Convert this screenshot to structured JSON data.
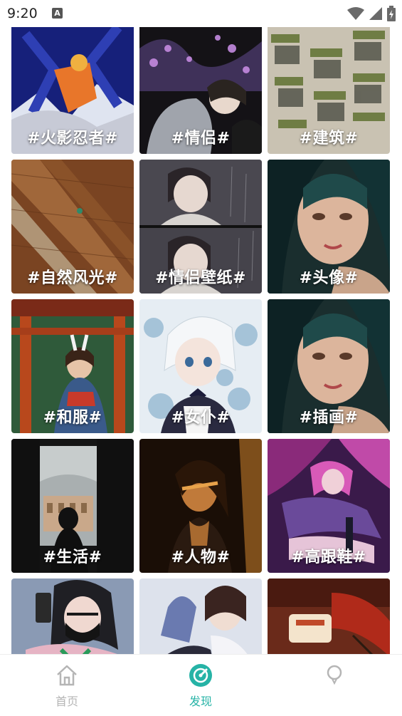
{
  "status_bar": {
    "time": "9:20",
    "notification_glyph": "A"
  },
  "tiles": [
    {
      "label": "#火影忍者#",
      "colors": [
        "#101a6b",
        "#2c3aa8",
        "#e8762a"
      ]
    },
    {
      "label": "#情侣#",
      "colors": [
        "#141216",
        "#3e3550",
        "#b07ad0"
      ]
    },
    {
      "label": "#建筑#",
      "colors": [
        "#b8b2a4",
        "#7d8b55",
        "#dcd6c8"
      ]
    },
    {
      "label": "#自然风光#",
      "colors": [
        "#6b3a1c",
        "#9a5a2e",
        "#c08a5e"
      ]
    },
    {
      "label": "#情侣壁纸#",
      "colors": [
        "#3a3a40",
        "#686670",
        "#d9d3cd"
      ]
    },
    {
      "label": "#头像#",
      "colors": [
        "#0f2a2c",
        "#1f4a4a",
        "#d6b39a"
      ]
    },
    {
      "label": "#和服#",
      "colors": [
        "#5a2a1a",
        "#2f5a3a",
        "#c85a2a"
      ]
    },
    {
      "label": "#女仆#",
      "colors": [
        "#d7e2ec",
        "#8fb4cf",
        "#f3f5f7"
      ]
    },
    {
      "label": "#插画#",
      "colors": [
        "#0f2a2c",
        "#1f4a4a",
        "#d6b39a"
      ]
    },
    {
      "label": "#生活#",
      "colors": [
        "#1a1a1a",
        "#3a3630",
        "#c9b49c"
      ]
    },
    {
      "label": "#人物#",
      "colors": [
        "#1c1008",
        "#6b3a12",
        "#d98a3a"
      ]
    },
    {
      "label": "#高跟鞋#",
      "colors": [
        "#3a1a4a",
        "#9a3a8a",
        "#e06ac8"
      ]
    },
    {
      "label": "",
      "colors": [
        "#7a8aa4",
        "#e0b8c0",
        "#2a2a2a"
      ]
    },
    {
      "label": "",
      "colors": [
        "#d8dce8",
        "#2a2a3a",
        "#6a7ab0"
      ]
    },
    {
      "label": "",
      "colors": [
        "#6a2a1a",
        "#c9a88a",
        "#f2d0a8"
      ]
    }
  ],
  "bottom_nav": {
    "items": [
      {
        "label": "首页",
        "icon": "home-icon"
      },
      {
        "label": "发现",
        "icon": "discover-icon"
      },
      {
        "label": "",
        "icon": "profile-icon"
      }
    ],
    "active_color": "#26b3a6",
    "inactive_color": "#b5b5b5"
  }
}
